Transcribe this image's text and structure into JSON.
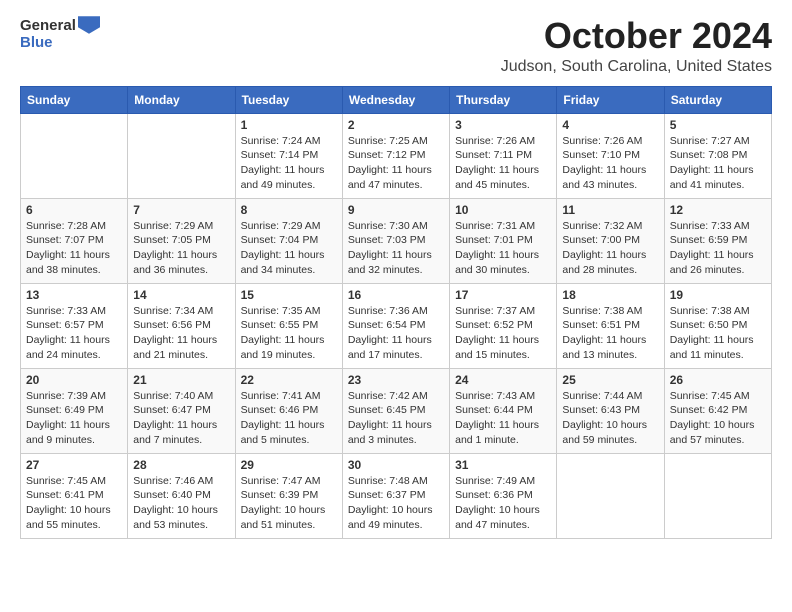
{
  "header": {
    "logo_general": "General",
    "logo_blue": "Blue",
    "title": "October 2024",
    "subtitle": "Judson, South Carolina, United States"
  },
  "weekdays": [
    "Sunday",
    "Monday",
    "Tuesday",
    "Wednesday",
    "Thursday",
    "Friday",
    "Saturday"
  ],
  "weeks": [
    [
      {
        "day": "",
        "info": ""
      },
      {
        "day": "",
        "info": ""
      },
      {
        "day": "1",
        "info": "Sunrise: 7:24 AM\nSunset: 7:14 PM\nDaylight: 11 hours and 49 minutes."
      },
      {
        "day": "2",
        "info": "Sunrise: 7:25 AM\nSunset: 7:12 PM\nDaylight: 11 hours and 47 minutes."
      },
      {
        "day": "3",
        "info": "Sunrise: 7:26 AM\nSunset: 7:11 PM\nDaylight: 11 hours and 45 minutes."
      },
      {
        "day": "4",
        "info": "Sunrise: 7:26 AM\nSunset: 7:10 PM\nDaylight: 11 hours and 43 minutes."
      },
      {
        "day": "5",
        "info": "Sunrise: 7:27 AM\nSunset: 7:08 PM\nDaylight: 11 hours and 41 minutes."
      }
    ],
    [
      {
        "day": "6",
        "info": "Sunrise: 7:28 AM\nSunset: 7:07 PM\nDaylight: 11 hours and 38 minutes."
      },
      {
        "day": "7",
        "info": "Sunrise: 7:29 AM\nSunset: 7:05 PM\nDaylight: 11 hours and 36 minutes."
      },
      {
        "day": "8",
        "info": "Sunrise: 7:29 AM\nSunset: 7:04 PM\nDaylight: 11 hours and 34 minutes."
      },
      {
        "day": "9",
        "info": "Sunrise: 7:30 AM\nSunset: 7:03 PM\nDaylight: 11 hours and 32 minutes."
      },
      {
        "day": "10",
        "info": "Sunrise: 7:31 AM\nSunset: 7:01 PM\nDaylight: 11 hours and 30 minutes."
      },
      {
        "day": "11",
        "info": "Sunrise: 7:32 AM\nSunset: 7:00 PM\nDaylight: 11 hours and 28 minutes."
      },
      {
        "day": "12",
        "info": "Sunrise: 7:33 AM\nSunset: 6:59 PM\nDaylight: 11 hours and 26 minutes."
      }
    ],
    [
      {
        "day": "13",
        "info": "Sunrise: 7:33 AM\nSunset: 6:57 PM\nDaylight: 11 hours and 24 minutes."
      },
      {
        "day": "14",
        "info": "Sunrise: 7:34 AM\nSunset: 6:56 PM\nDaylight: 11 hours and 21 minutes."
      },
      {
        "day": "15",
        "info": "Sunrise: 7:35 AM\nSunset: 6:55 PM\nDaylight: 11 hours and 19 minutes."
      },
      {
        "day": "16",
        "info": "Sunrise: 7:36 AM\nSunset: 6:54 PM\nDaylight: 11 hours and 17 minutes."
      },
      {
        "day": "17",
        "info": "Sunrise: 7:37 AM\nSunset: 6:52 PM\nDaylight: 11 hours and 15 minutes."
      },
      {
        "day": "18",
        "info": "Sunrise: 7:38 AM\nSunset: 6:51 PM\nDaylight: 11 hours and 13 minutes."
      },
      {
        "day": "19",
        "info": "Sunrise: 7:38 AM\nSunset: 6:50 PM\nDaylight: 11 hours and 11 minutes."
      }
    ],
    [
      {
        "day": "20",
        "info": "Sunrise: 7:39 AM\nSunset: 6:49 PM\nDaylight: 11 hours and 9 minutes."
      },
      {
        "day": "21",
        "info": "Sunrise: 7:40 AM\nSunset: 6:47 PM\nDaylight: 11 hours and 7 minutes."
      },
      {
        "day": "22",
        "info": "Sunrise: 7:41 AM\nSunset: 6:46 PM\nDaylight: 11 hours and 5 minutes."
      },
      {
        "day": "23",
        "info": "Sunrise: 7:42 AM\nSunset: 6:45 PM\nDaylight: 11 hours and 3 minutes."
      },
      {
        "day": "24",
        "info": "Sunrise: 7:43 AM\nSunset: 6:44 PM\nDaylight: 11 hours and 1 minute."
      },
      {
        "day": "25",
        "info": "Sunrise: 7:44 AM\nSunset: 6:43 PM\nDaylight: 10 hours and 59 minutes."
      },
      {
        "day": "26",
        "info": "Sunrise: 7:45 AM\nSunset: 6:42 PM\nDaylight: 10 hours and 57 minutes."
      }
    ],
    [
      {
        "day": "27",
        "info": "Sunrise: 7:45 AM\nSunset: 6:41 PM\nDaylight: 10 hours and 55 minutes."
      },
      {
        "day": "28",
        "info": "Sunrise: 7:46 AM\nSunset: 6:40 PM\nDaylight: 10 hours and 53 minutes."
      },
      {
        "day": "29",
        "info": "Sunrise: 7:47 AM\nSunset: 6:39 PM\nDaylight: 10 hours and 51 minutes."
      },
      {
        "day": "30",
        "info": "Sunrise: 7:48 AM\nSunset: 6:37 PM\nDaylight: 10 hours and 49 minutes."
      },
      {
        "day": "31",
        "info": "Sunrise: 7:49 AM\nSunset: 6:36 PM\nDaylight: 10 hours and 47 minutes."
      },
      {
        "day": "",
        "info": ""
      },
      {
        "day": "",
        "info": ""
      }
    ]
  ]
}
